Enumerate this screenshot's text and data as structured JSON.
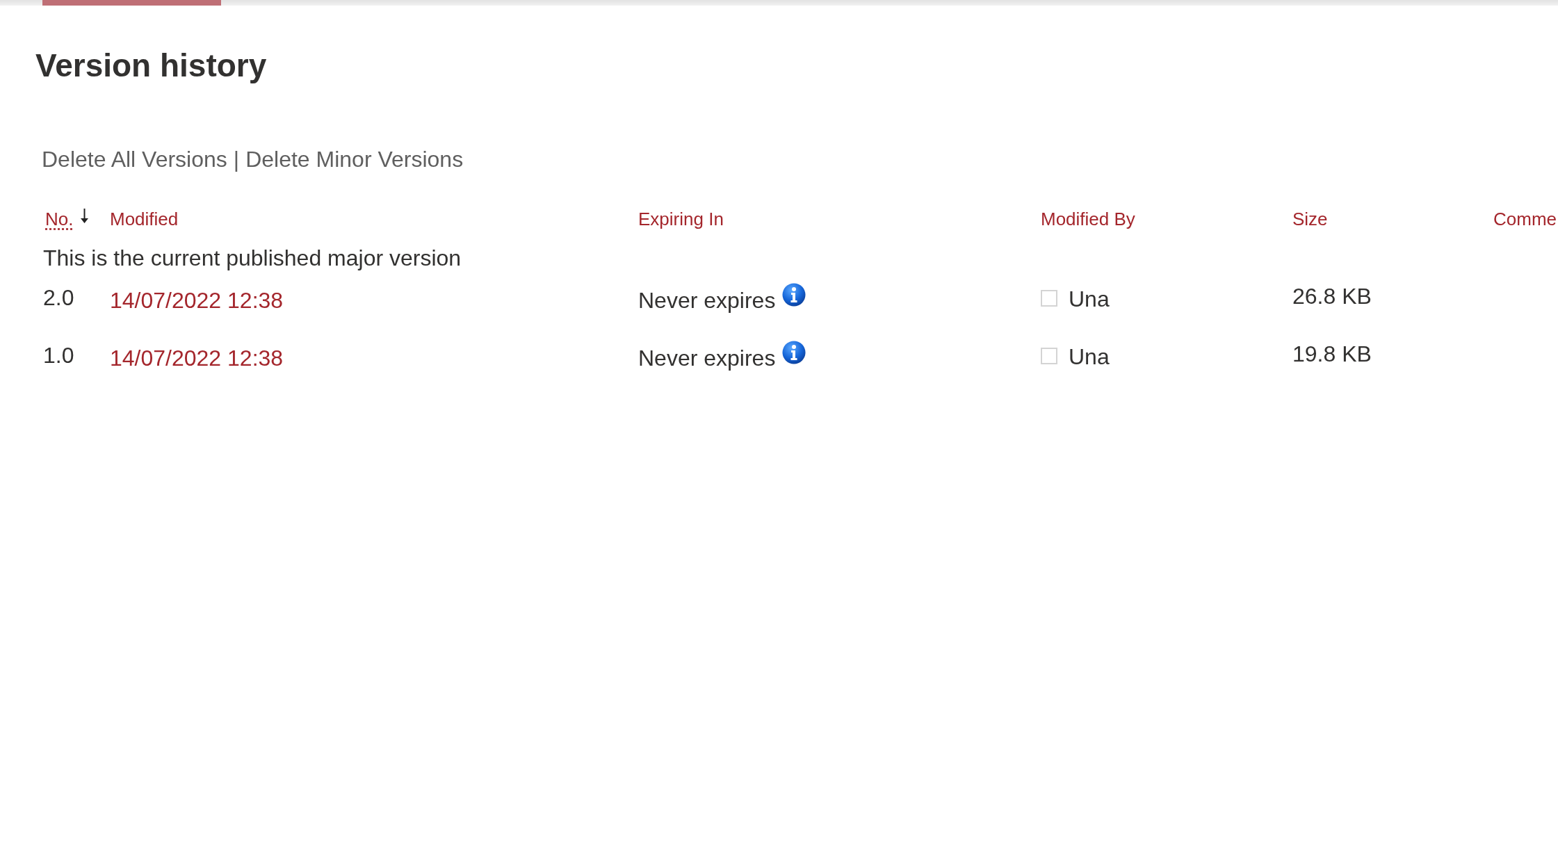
{
  "loading": true,
  "title": "Version history",
  "actions": {
    "links": [
      "Delete All Versions",
      "Delete Minor Versions"
    ],
    "separator": "|"
  },
  "table": {
    "columns": [
      {
        "label": "No.",
        "kind": "abbreviation",
        "sorted": true
      },
      {
        "label": "Modified",
        "kind": "plain",
        "sorted": false
      },
      {
        "label": "Expiring In",
        "kind": "plain",
        "sorted": false
      },
      {
        "label": "Modified By",
        "kind": "plain",
        "sorted": false
      },
      {
        "label": "Size",
        "kind": "plain",
        "sorted": false
      },
      {
        "label": "Comme",
        "kind": "plain",
        "sorted": false
      }
    ],
    "group_heading": "This is the current published major version",
    "rows": [
      {
        "no": "2.0",
        "modified": "14/07/2022 12:38",
        "expiring_in": "Never expires",
        "modified_by": {
          "name": "Una",
          "checked": false
        },
        "size": "26.8 KB"
      },
      {
        "no": "1.0",
        "modified": "14/07/2022 12:38",
        "expiring_in": "Never expires",
        "modified_by": {
          "name": "Una",
          "checked": false
        },
        "size": "19.8 KB"
      }
    ]
  }
}
